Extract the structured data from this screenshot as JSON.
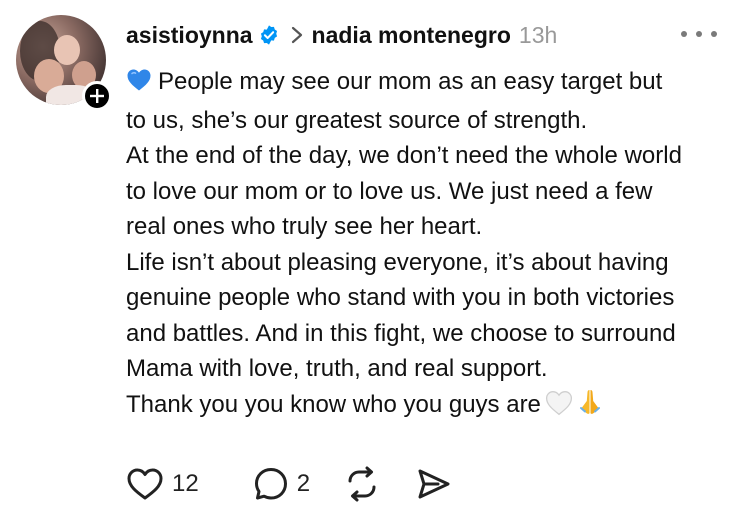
{
  "post": {
    "author": {
      "username": "asistioynna",
      "avatar_icon": "avatar",
      "verified_icon": "verified-badge-icon",
      "follow_icon": "plus-icon"
    },
    "reply_to": "nadia montenegro",
    "timestamp": "13h",
    "menu_icon": "more-icon",
    "content_lines": [
      "People may see our mom as an easy target  but",
      "to us, she’s our greatest source of strength.",
      "At the end of the day, we don’t need the whole world",
      "to love our mom or to love us. We just need a few",
      "real ones who truly see her heart.",
      "Life isn’t about pleasing everyone, it’s about having",
      "genuine people who stand with you in both victories",
      "and battles. And in this fight, we choose to surround",
      "Mama with love, truth, and real support.",
      "Thank you you know who you guys are"
    ],
    "emojis": {
      "leading": "blue-heart-emoji",
      "trailing": [
        "white-heart-emoji",
        "folded-hands-emoji"
      ]
    }
  },
  "actions": {
    "like": {
      "icon": "heart-icon",
      "count": "12"
    },
    "reply": {
      "icon": "comment-icon",
      "count": "2"
    },
    "repost": {
      "icon": "repost-icon"
    },
    "share": {
      "icon": "send-icon"
    }
  },
  "colors": {
    "text": "#111111",
    "muted": "#999999",
    "verified": "#0095f6",
    "icon": "#222222"
  }
}
